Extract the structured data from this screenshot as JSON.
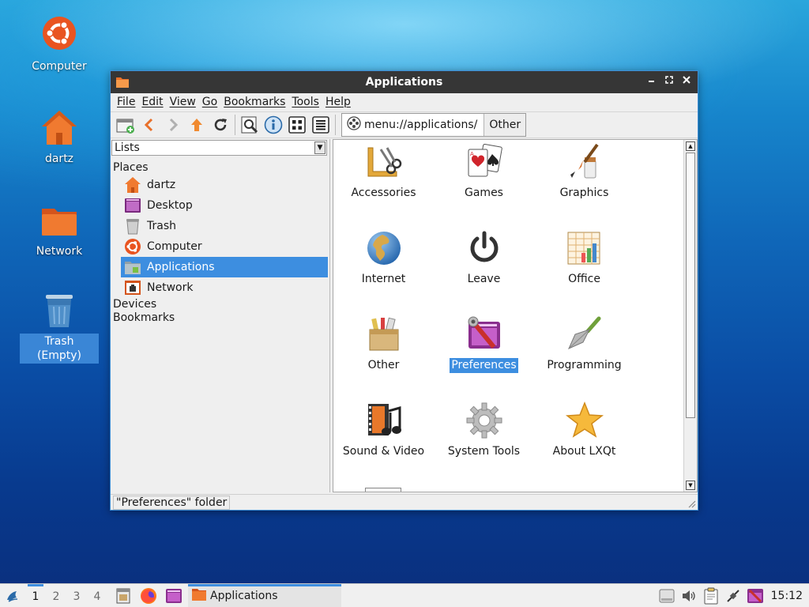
{
  "desktop": {
    "icons": [
      {
        "label": "Computer"
      },
      {
        "label": "dartz"
      },
      {
        "label": "Network"
      },
      {
        "label": "Trash (Empty)"
      }
    ]
  },
  "window": {
    "title": "Applications",
    "menu": [
      "File",
      "Edit",
      "View",
      "Go",
      "Bookmarks",
      "Tools",
      "Help"
    ],
    "path": "menu://applications/",
    "crumb": "Other",
    "side": {
      "combo": "Lists",
      "places_header": "Places",
      "places": [
        {
          "label": "dartz",
          "icon": "home-folder-icon"
        },
        {
          "label": "Desktop",
          "icon": "desktop-icon"
        },
        {
          "label": "Trash",
          "icon": "trash-icon"
        },
        {
          "label": "Computer",
          "icon": "computer-icon"
        },
        {
          "label": "Applications",
          "icon": "applications-icon",
          "selected": true
        },
        {
          "label": "Network",
          "icon": "network-icon"
        }
      ],
      "devices_header": "Devices",
      "bookmarks_header": "Bookmarks"
    },
    "apps": [
      {
        "label": "Accessories"
      },
      {
        "label": "Games"
      },
      {
        "label": "Graphics"
      },
      {
        "label": "Internet"
      },
      {
        "label": "Leave"
      },
      {
        "label": "Office"
      },
      {
        "label": "Other"
      },
      {
        "label": "Preferences",
        "selected": true
      },
      {
        "label": "Programming"
      },
      {
        "label": "Sound & Video"
      },
      {
        "label": "System Tools"
      },
      {
        "label": "About LXQt"
      }
    ],
    "status": "\"Preferences\" folder"
  },
  "taskbar": {
    "desktops": [
      "1",
      "2",
      "3",
      "4"
    ],
    "task_label": "Applications",
    "clock": "15:12"
  },
  "colors": {
    "accent": "#3d8ee0",
    "titlebar": "#363636"
  }
}
